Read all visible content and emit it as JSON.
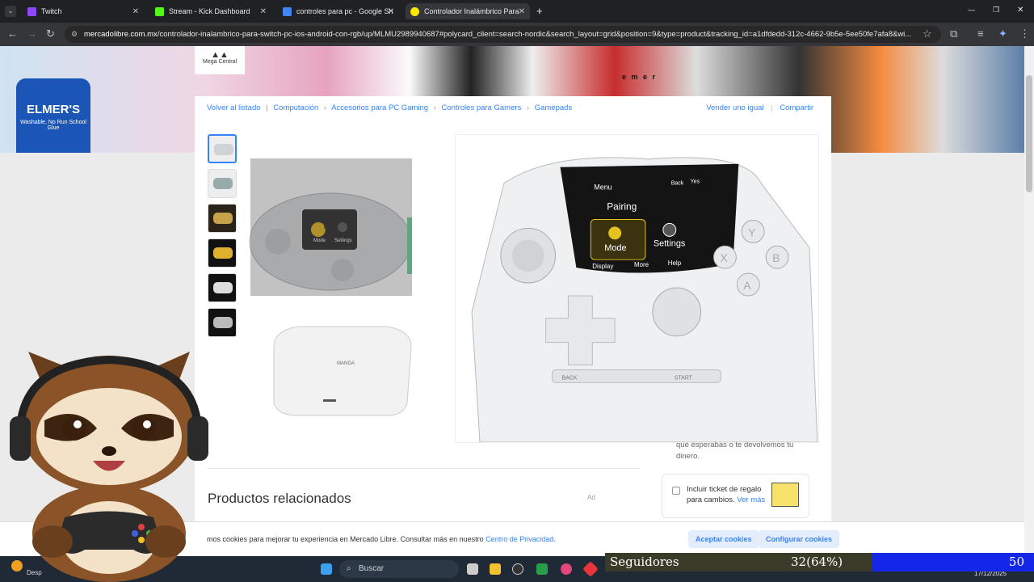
{
  "tabs": [
    {
      "title": "Twitch",
      "color": "#9146ff",
      "active": false
    },
    {
      "title": "Stream - Kick Dashboard",
      "color": "#53fc18",
      "active": false
    },
    {
      "title": "controles para pc - Google Sho",
      "color": "#4285f4",
      "active": false
    },
    {
      "title": "Controlador Inalámbrico Para S",
      "color": "#ffe600",
      "active": true
    }
  ],
  "tab_close": "✕",
  "new_tab": "+",
  "window_controls": {
    "minimize": "—",
    "restore": "❐",
    "close": "✕"
  },
  "address": {
    "domain": "mercadolibre.com.mx",
    "path": "/controlador-inalambrico-para-switch-pc-ios-android-con-rgb/up/MLMU2989940687#polycard_client=search-nordic&search_layout=grid&position=9&type=product&tracking_id=a1dfdedd-312c-4662-9b5e-5ee50fe7afa8&wi..."
  },
  "banner": {
    "brand": "ELMER'S",
    "brand_sub": "Washable, No Run School Glue",
    "seller_logo": "Mega Central",
    "headphones_text": "e m e r"
  },
  "breadcrumbs": [
    "Volver al listado",
    "Computación",
    "Accesorios para PC Gaming",
    "Controles para Gamers",
    "Gamepads"
  ],
  "actions": {
    "sell_same": "Vender uno igual",
    "share": "Compartir"
  },
  "zoom_screen": {
    "menu": "Menu",
    "back": "Back",
    "yes": "Yes",
    "pairing": "Pairing",
    "mode": "Mode",
    "settings": "Settings",
    "display": "Display",
    "more": "More",
    "help": "Help",
    "back_btn": "BACK",
    "start_btn": "START",
    "face_buttons": [
      "Y",
      "X",
      "B",
      "A"
    ]
  },
  "thumb_screen": {
    "mode": "Mode",
    "settings": "Settings",
    "stand_label": "MANGA"
  },
  "side_text": "que esperabas o te devolvemos tu dinero.",
  "related": {
    "title": "Productos relacionados",
    "ad": "Ad"
  },
  "gift": {
    "label": "Incluir ticket de regalo para cambios.",
    "link": "Ver más"
  },
  "cookie": {
    "text": "mos cookies para mejorar tu experiencia en Mercado Libre. Consultar más en nuestro",
    "link": "Centro de Privacidad.",
    "accept": "Aceptar cookies",
    "configure": "Configurar cookies"
  },
  "taskbar": {
    "search": "Buscar",
    "clock": "17/12/2025",
    "left_label": "Desp"
  },
  "followers_overlay": {
    "label": "Seguidores",
    "progress": "32(64%)",
    "goal": "50"
  }
}
